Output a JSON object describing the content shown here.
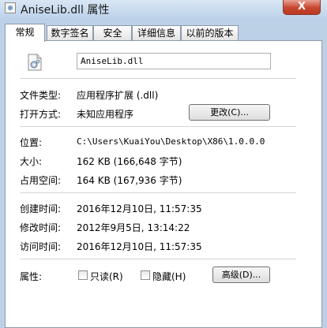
{
  "window": {
    "title": "AniseLib.dll 属性",
    "close_label": "X",
    "icon": "file-properties-icon"
  },
  "tabs": [
    {
      "label": "常规",
      "active": true
    },
    {
      "label": "数字签名",
      "active": false
    },
    {
      "label": "安全",
      "active": false
    },
    {
      "label": "详细信息",
      "active": false
    },
    {
      "label": "以前的版本",
      "active": false
    }
  ],
  "general": {
    "file_icon": "dll-file-icon",
    "file_name": "AniseLib.dll",
    "type_label": "文件类型:",
    "type_value": "应用程序扩展 (.dll)",
    "opens_label": "打开方式:",
    "opens_value": "未知应用程序",
    "change_button": "更改(C)...",
    "location_label": "位置:",
    "location_value": "C:\\Users\\KuaiYou\\Desktop\\X86\\1.0.0.0",
    "size_label": "大小:",
    "size_value": "162 KB (166,648 字节)",
    "size_on_disk_label": "占用空间:",
    "size_on_disk_value": "164 KB (167,936 字节)",
    "created_label": "创建时间:",
    "created_value": "2016年12月10日, 11:57:35",
    "modified_label": "修改时间:",
    "modified_value": "2012年9月5日, 13:14:22",
    "accessed_label": "访问时间:",
    "accessed_value": "2016年12月10日, 11:57:35",
    "attributes_label": "属性:",
    "readonly_label": "只读(R)",
    "readonly_checked": false,
    "hidden_label": "隐藏(H)",
    "hidden_checked": false,
    "advanced_button": "高级(D)..."
  }
}
